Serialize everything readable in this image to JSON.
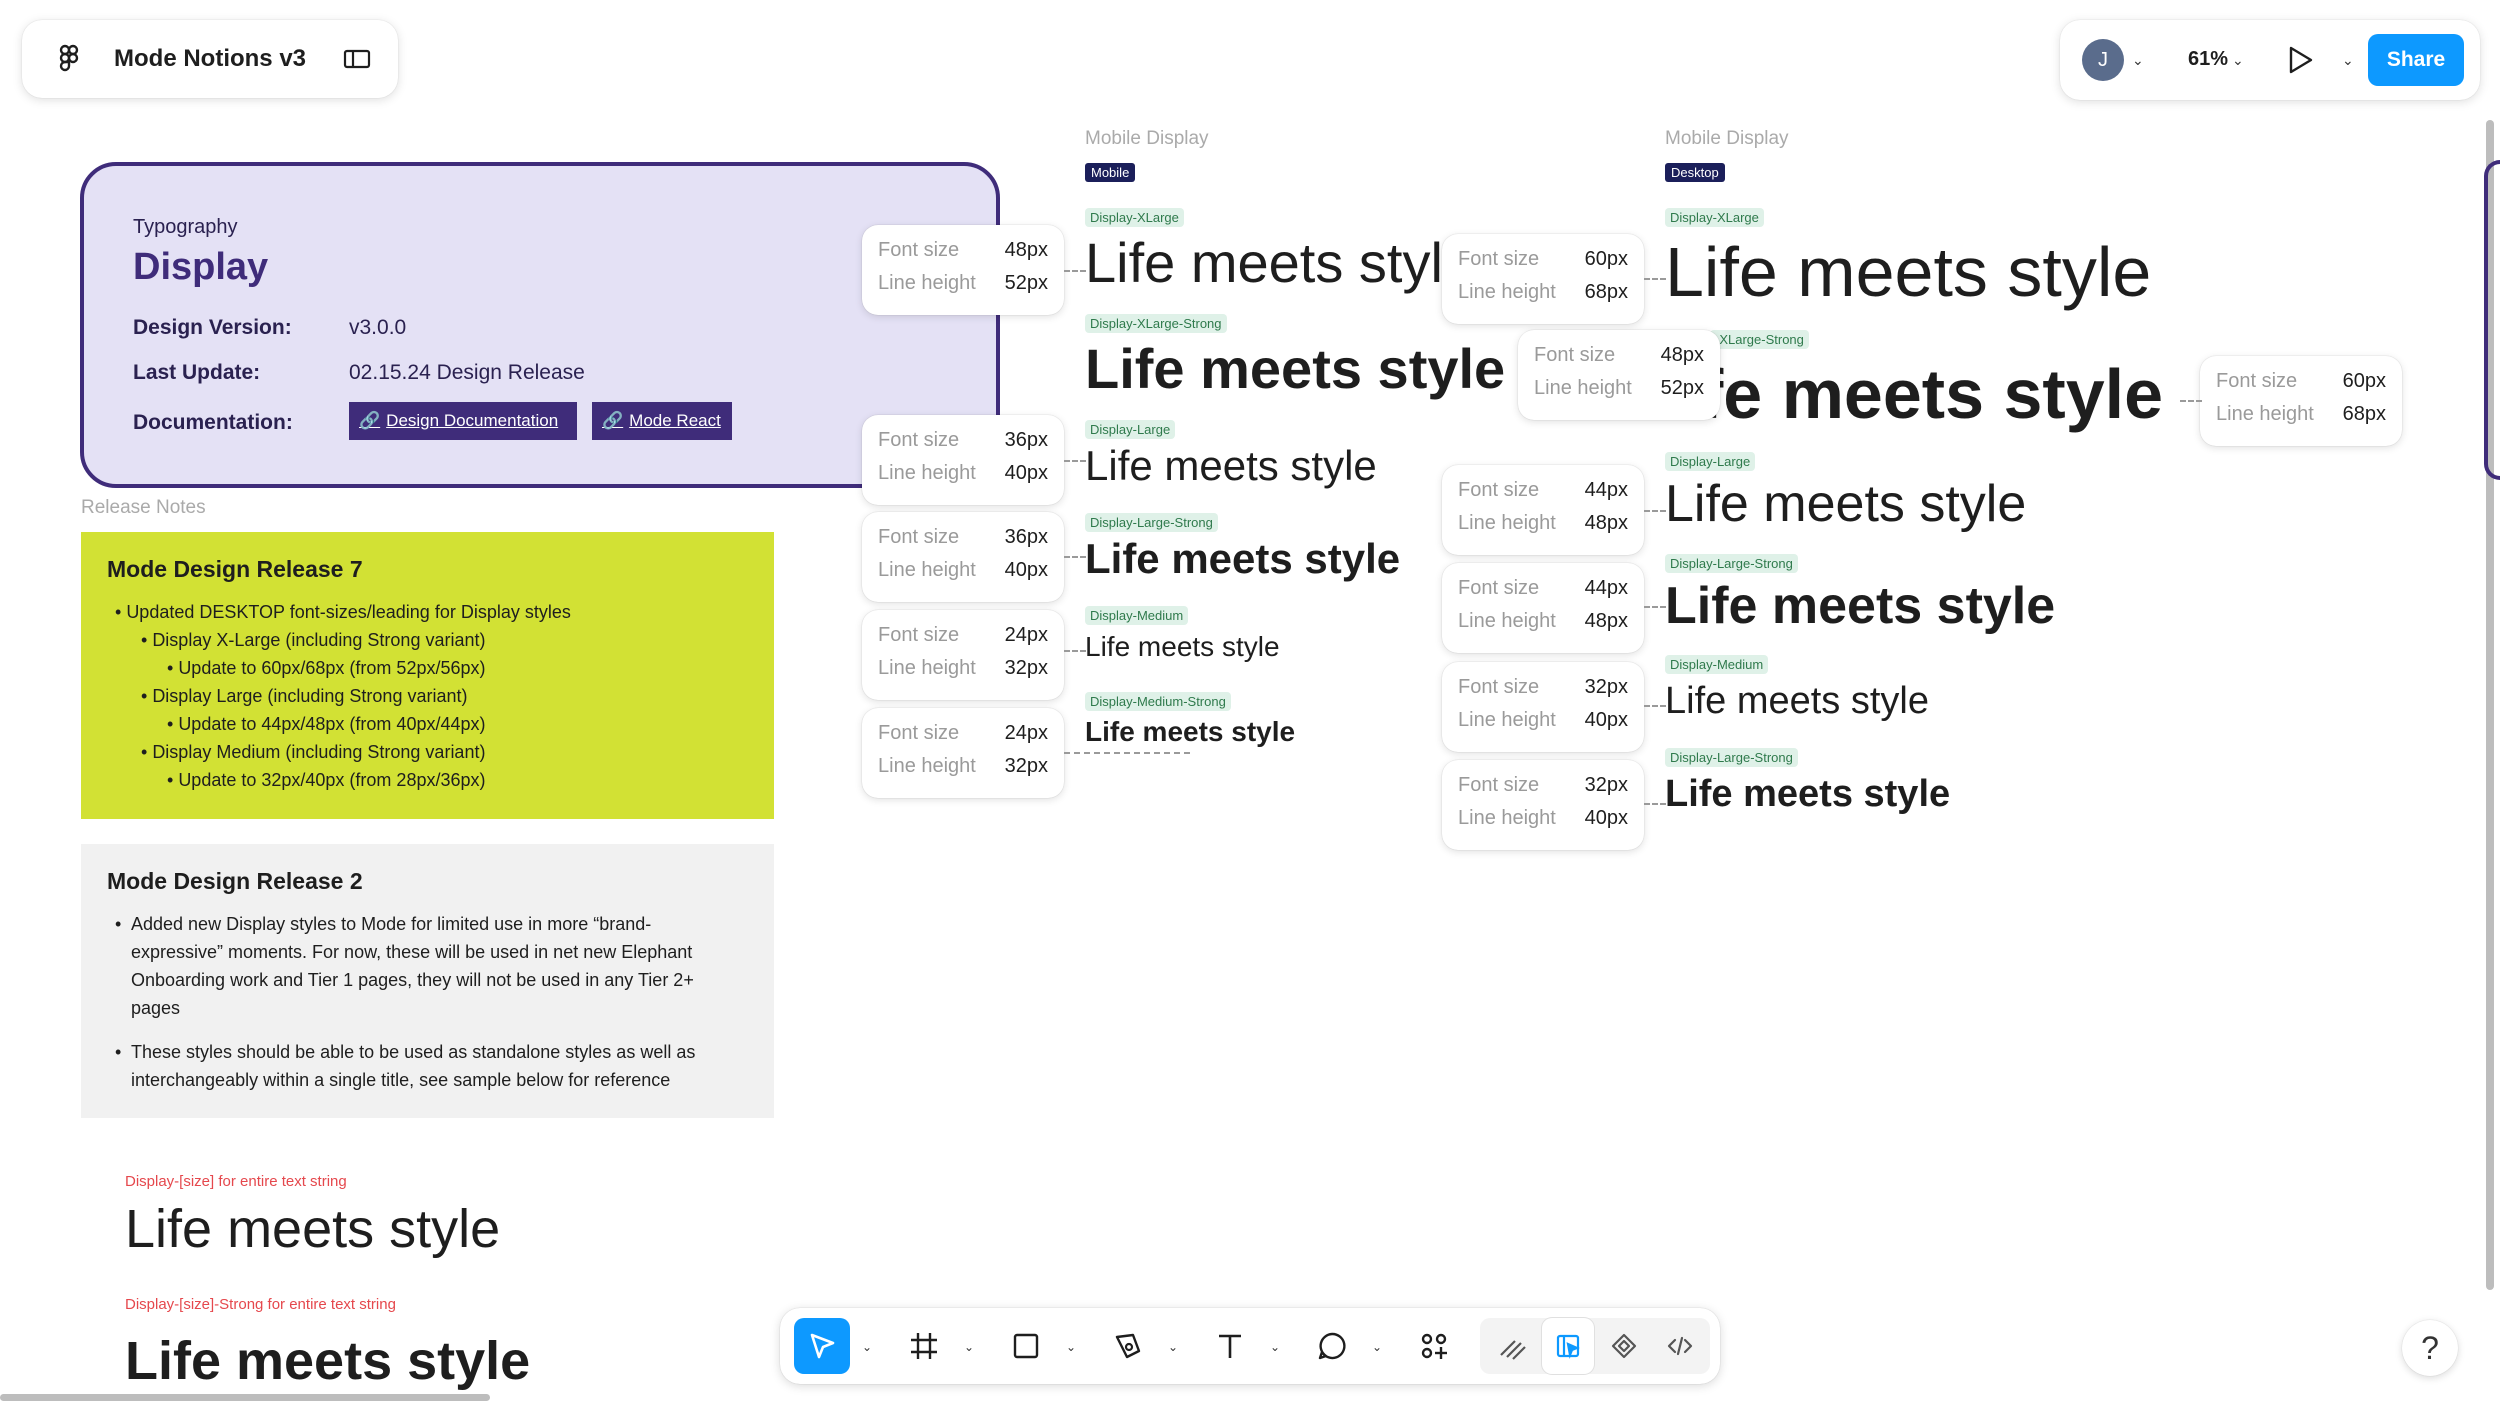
{
  "app": {
    "file_title": "Mode Notions v3"
  },
  "topbar": {
    "avatar_initial": "J",
    "zoom": "61%",
    "share_label": "Share"
  },
  "card": {
    "kicker": "Typography",
    "title": "Display",
    "rows": [
      {
        "label": "Design Version:",
        "value": "v3.0.0"
      },
      {
        "label": "Last Update:",
        "value": "02.15.24 Design Release"
      },
      {
        "label": "Documentation:"
      }
    ],
    "links": [
      "Design Documentation",
      "Mode React"
    ]
  },
  "release_notes": {
    "label": "Release Notes",
    "r7": {
      "title": "Mode Design Release 7",
      "items": [
        "Updated DESKTOP font-sizes/leading for Display styles",
        "Display X-Large (including Strong variant)",
        "Update to 60px/68px (from 52px/56px)",
        "Display Large (including Strong variant)",
        "Update to 44px/48px (from 40px/44px)",
        "Display Medium (including Strong variant)",
        "Update to 32px/40px (from 28px/36px)"
      ]
    },
    "r2": {
      "title": "Mode Design Release 2",
      "items": [
        "Added new Display styles to Mode for limited use in more “brand-expressive” moments. For now, these will be used in net new Elephant Onboarding work and Tier 1 pages, they will not be used in any Tier 2+ pages",
        "These styles should be able to be used as standalone styles as well as interchangeably within a single title, see sample below for reference"
      ]
    }
  },
  "bottom_samples": {
    "note1": "Display-[size] for entire text string",
    "note2": "Display-[size]-Strong for entire text string",
    "sample": "Life meets style"
  },
  "spec": {
    "font_size_label": "Font size",
    "line_height_label": "Line height"
  },
  "mobile": {
    "heading": "Mobile Display",
    "badge": "Mobile",
    "styles": [
      {
        "tag": "Display-XLarge",
        "fs": "48px",
        "lh": "52px",
        "sample": "Life meets style"
      },
      {
        "tag": "Display-XLarge-Strong",
        "fs": "36px",
        "lh": "40px",
        "sample": "Life meets style"
      },
      {
        "tag": "Display-Large",
        "fs": "36px",
        "lh": "40px",
        "sample": "Life meets style"
      },
      {
        "tag": "Display-Large-Strong",
        "fs": "24px",
        "lh": "32px",
        "sample": "Life meets style"
      },
      {
        "tag": "Display-Medium",
        "fs": "24px",
        "lh": "32px",
        "sample": "Life meets style"
      },
      {
        "tag": "Display-Medium-Strong",
        "sample": "Life meets style"
      }
    ]
  },
  "desktop": {
    "heading": "Mobile Display",
    "badge": "Desktop",
    "styles": [
      {
        "tag": "Display-XLarge",
        "fs": "60px",
        "lh": "68px",
        "sample": "Life meets style"
      },
      {
        "tag": "-XLarge-Strong",
        "fs": "48px",
        "lh": "52px",
        "sample": "fe meets style"
      },
      {
        "tag": "Display-Large",
        "fs": "60px",
        "lh": "68px",
        "sample": "Life meets style"
      },
      {
        "tag": "Display-Large-Strong",
        "fs": "44px",
        "lh": "48px",
        "sample": "Life meets style"
      },
      {
        "tag": "Display-Medium",
        "fs": "44px",
        "lh": "48px",
        "sample": "Life meets style"
      },
      {
        "tag": "Display-Large-Strong",
        "fs": "32px",
        "lh": "40px",
        "sample": "Life meets style"
      },
      {
        "fs": "32px",
        "lh": "40px"
      }
    ]
  },
  "help": {
    "label": "?"
  }
}
